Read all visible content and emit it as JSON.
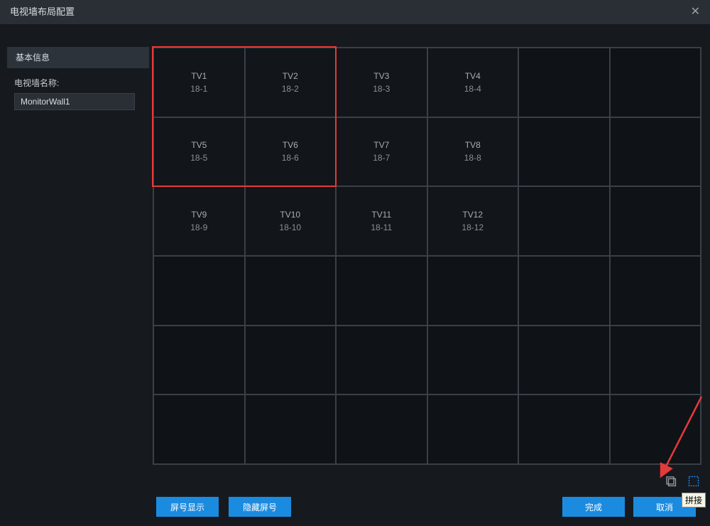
{
  "window": {
    "title": "电视墙布局配置"
  },
  "sidebar": {
    "section_title": "基本信息",
    "name_label": "电视墙名称:",
    "name_value": "MonitorWall1"
  },
  "grid": {
    "cols": 6,
    "rows": 6,
    "selection": {
      "row_start": 0,
      "col_start": 0,
      "row_end": 1,
      "col_end": 1
    },
    "cells": [
      {
        "row": 0,
        "col": 0,
        "name": "TV1",
        "id": "18-1"
      },
      {
        "row": 0,
        "col": 1,
        "name": "TV2",
        "id": "18-2"
      },
      {
        "row": 0,
        "col": 2,
        "name": "TV3",
        "id": "18-3"
      },
      {
        "row": 0,
        "col": 3,
        "name": "TV4",
        "id": "18-4"
      },
      {
        "row": 1,
        "col": 0,
        "name": "TV5",
        "id": "18-5"
      },
      {
        "row": 1,
        "col": 1,
        "name": "TV6",
        "id": "18-6"
      },
      {
        "row": 1,
        "col": 2,
        "name": "TV7",
        "id": "18-7"
      },
      {
        "row": 1,
        "col": 3,
        "name": "TV8",
        "id": "18-8"
      },
      {
        "row": 2,
        "col": 0,
        "name": "TV9",
        "id": "18-9"
      },
      {
        "row": 2,
        "col": 1,
        "name": "TV10",
        "id": "18-10"
      },
      {
        "row": 2,
        "col": 2,
        "name": "TV11",
        "id": "18-11"
      },
      {
        "row": 2,
        "col": 3,
        "name": "TV12",
        "id": "18-12"
      }
    ]
  },
  "tool_icons": {
    "clear": "clear-icon",
    "splice": "splice-icon"
  },
  "tooltip": {
    "splice": "拼接"
  },
  "footer": {
    "show_screen": "屏号显示",
    "hide_screen": "隐藏屏号",
    "finish": "完成",
    "cancel": "取消"
  },
  "colors": {
    "accent": "#1b8be0",
    "selection": "#e53a3a",
    "arrow": "#e53a3a"
  }
}
